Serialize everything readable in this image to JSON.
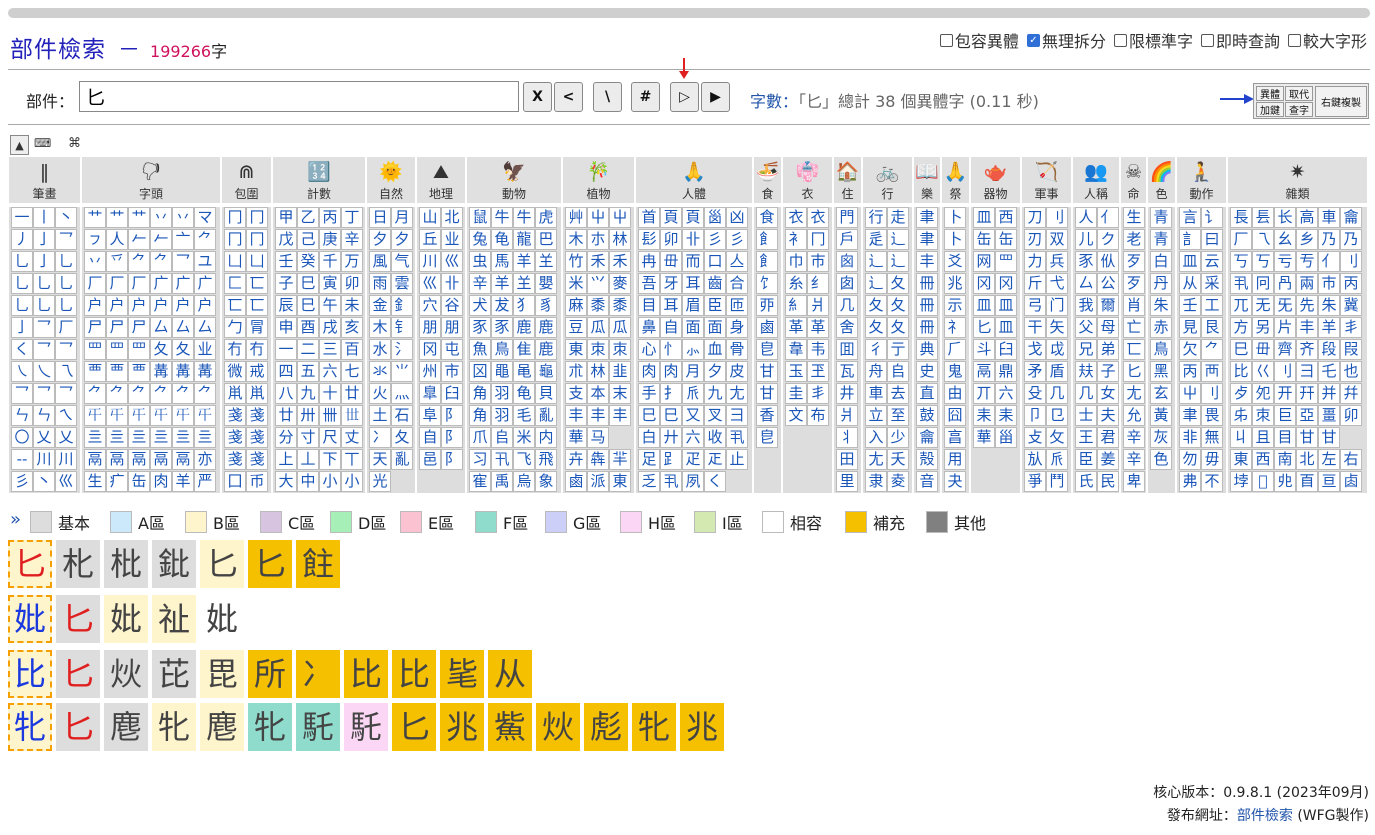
{
  "title": {
    "text": "部件檢索",
    "dash": "－",
    "count": "199266",
    "unit": "字"
  },
  "options": [
    {
      "label": "包容異體",
      "checked": false
    },
    {
      "label": "無理拆分",
      "checked": true
    },
    {
      "label": "限標準字",
      "checked": false
    },
    {
      "label": "即時查詢",
      "checked": false
    },
    {
      "label": "較大字形",
      "checked": false
    }
  ],
  "search": {
    "label": "部件：",
    "value": "匕"
  },
  "buttons": [
    "X",
    "<",
    "\\",
    "#",
    "▷",
    "▶"
  ],
  "info": {
    "label": "字數：",
    "text": "「匕」總計 38 個異體字 (0.11 秒)"
  },
  "mini_panel": {
    "b1": "異體",
    "b2": "取代",
    "b3": "加鍵",
    "b4": "查字",
    "b5": "右鍵複製"
  },
  "tools": {
    "triangle": "▲",
    "keyboard": "⌨",
    "command": "⌘"
  },
  "colors": {
    "accent": "#2255aa",
    "count": "#d0115d",
    "highlight": "#e02020",
    "cellText": "#1a56b8"
  },
  "categories": [
    {
      "label": "筆畫",
      "icon": "‖"
    },
    {
      "label": "字頭",
      "icon": "🖓"
    },
    {
      "label": "包圍",
      "icon": "⋒"
    },
    {
      "label": "計數",
      "icon": "🔢"
    },
    {
      "label": "自然",
      "icon": "🌞"
    },
    {
      "label": "地理",
      "icon": "⛰"
    },
    {
      "label": "動物",
      "icon": "🦅"
    },
    {
      "label": "植物",
      "icon": "🎋"
    },
    {
      "label": "人體",
      "icon": "🙏"
    },
    {
      "label": "食",
      "icon": "🍜"
    },
    {
      "label": "衣",
      "icon": "👘"
    },
    {
      "label": "住",
      "icon": "🏠"
    },
    {
      "label": "行",
      "icon": "🚲"
    },
    {
      "label": "樂",
      "icon": "📖"
    },
    {
      "label": "祭",
      "icon": "🙏"
    },
    {
      "label": "器物",
      "icon": "🫖"
    },
    {
      "label": "軍事",
      "icon": "🏹"
    },
    {
      "label": "人稱",
      "icon": "👥"
    },
    {
      "label": "命",
      "icon": "☠"
    },
    {
      "label": "色",
      "icon": "🌈"
    },
    {
      "label": "動作",
      "icon": "🧎"
    },
    {
      "label": "雜類",
      "icon": "✷"
    }
  ],
  "grid": [
    [
      "一",
      "丨",
      "丶",
      "艹",
      "艹",
      "艹",
      "丷",
      "丷",
      "マ",
      "冂",
      "冂",
      "甲",
      "乙",
      "丙",
      "丁",
      "日",
      "月",
      "山",
      "北",
      "鼠",
      "牛",
      "牛",
      "虎",
      "艸",
      "屮",
      "屮",
      "首",
      "頁",
      "頁",
      "𡿺",
      "凶",
      "食",
      "衣",
      "衣",
      "門",
      "行",
      "走",
      "聿",
      "卜",
      "皿",
      "西",
      "刀",
      "刂",
      "人",
      "亻",
      "生",
      "青",
      "言",
      "讠",
      "長",
      "镸",
      "长",
      "高",
      "車",
      "龠"
    ],
    [
      "丿",
      "亅",
      "乛",
      "ㇷ",
      "人",
      "𠂉",
      "𠂉",
      "亠",
      "⺈",
      "冂",
      "冂",
      "戊",
      "己",
      "庚",
      "辛",
      "夕",
      "夕",
      "丘",
      "业",
      "兔",
      "龟",
      "龍",
      "巴",
      "木",
      "朩",
      "林",
      "髟",
      "卯",
      "卝",
      "彡",
      "彡",
      "飠",
      "衤",
      "冂",
      "戶",
      "辵",
      "辶",
      "聿",
      "卜",
      "缶",
      "缶",
      "刃",
      "双",
      "儿",
      "ク",
      "老",
      "青",
      "訁",
      "曰",
      "厂",
      "乁",
      "幺",
      "乡",
      "乃",
      "乃"
    ],
    [
      "乚",
      "亅",
      "乚",
      "丷",
      "乊",
      "⺈",
      "⺈",
      "乛",
      "ユ",
      "凵",
      "凵",
      "壬",
      "癸",
      "千",
      "万",
      "風",
      "气",
      "川",
      "巛",
      "虫",
      "馬",
      "羊",
      "𦍌",
      "竹",
      "禾",
      "禾",
      "冉",
      "毌",
      "而",
      "口",
      "亼",
      "飠",
      "巾",
      "巿",
      "囪",
      "辶",
      "辶",
      "丰",
      "爻",
      "网",
      "罒",
      "力",
      "兵",
      "豕",
      "㐺",
      "歹",
      "白",
      "皿",
      "云",
      "丂",
      "丂",
      "亏",
      "亐",
      "亻",
      "刂"
    ],
    [
      "乚",
      "乚",
      "乚",
      "厂",
      "厂",
      "厂",
      "广",
      "广",
      "广",
      "匚",
      "匸",
      "子",
      "巳",
      "寅",
      "卯",
      "雨",
      "雲",
      "巛",
      "卝",
      "辛",
      "羊",
      "𦍌",
      "嬰",
      "米",
      "⺍",
      "麥",
      "吾",
      "牙",
      "耳",
      "齒",
      "合",
      "饣",
      "糸",
      "纟",
      "囱",
      "辶",
      "夂",
      "冊",
      "兆",
      "冈",
      "冈",
      "斤",
      "弋",
      "厶",
      "公",
      "歹",
      "丹",
      "从",
      "采",
      "丮",
      "冋",
      "冎",
      "兩",
      "巿",
      "丙"
    ],
    [
      "乚",
      "乚",
      "乚",
      "户",
      "户",
      "户",
      "户",
      "户",
      "户",
      "匸",
      "匸",
      "辰",
      "巳",
      "午",
      "未",
      "金",
      "釒",
      "穴",
      "谷",
      "犬",
      "犮",
      "犭",
      "豸",
      "麻",
      "黍",
      "黍",
      "目",
      "耳",
      "眉",
      "臣",
      "匝",
      "丣",
      "糹",
      "爿",
      "几",
      "夂",
      "夂",
      "冊",
      "示",
      "皿",
      "皿",
      "弓",
      "门",
      "我",
      "爾",
      "肖",
      "朱",
      "壬",
      "工",
      "兀",
      "无",
      "旡",
      "先",
      "朱",
      "冀"
    ],
    [
      "亅",
      "乛",
      "厂",
      "尸",
      "尸",
      "尸",
      "厶",
      "厶",
      "厶",
      "勹",
      "冐",
      "申",
      "酉",
      "戌",
      "亥",
      "木",
      "钅",
      "朋",
      "朋",
      "豕",
      "豕",
      "鹿",
      "鹿",
      "豆",
      "瓜",
      "瓜",
      "鼻",
      "自",
      "面",
      "面",
      "身",
      "鹵",
      "革",
      "革",
      "舍",
      "夂",
      "夂",
      "冊",
      "礻",
      "匕",
      "皿",
      "干",
      "矢",
      "父",
      "母",
      "亡",
      "赤",
      "見",
      "艮",
      "方",
      "另",
      "片",
      "丰",
      "羊",
      "丯"
    ],
    [
      "く",
      "乛",
      "乛",
      "罒",
      "罒",
      "罒",
      "夂",
      "夂",
      "业",
      "冇",
      "冇",
      "一",
      "二",
      "三",
      "百",
      "水",
      "氵",
      "冈",
      "屯",
      "魚",
      "鳥",
      "隹",
      "鹿",
      "東",
      "朿",
      "朿",
      "心",
      "忄",
      "⺗",
      "血",
      "骨",
      "皀",
      "韋",
      "韦",
      "囬",
      "彳",
      "亍",
      "典",
      "⺁",
      "斗",
      "臼",
      "戈",
      "戉",
      "兄",
      "弟",
      "匸",
      "鳥",
      "欠",
      "⺈",
      "巳",
      "毌",
      "齊",
      "齐",
      "段",
      "叚"
    ],
    [
      "㇏",
      "乀",
      "乁",
      "覀",
      "覀",
      "覀",
      "冓",
      "冓",
      "冓",
      "微",
      "戒",
      "四",
      "五",
      "六",
      "七",
      "氺",
      "⺌",
      "州",
      "市",
      "龱",
      "黽",
      "黾",
      "龜",
      "朮",
      "林",
      "韭",
      "肉",
      "肉",
      "月",
      "夕",
      "皮",
      "甘",
      "玉",
      "玊",
      "瓦",
      "舟",
      "𠂤",
      "史",
      "鬼",
      "鬲",
      "鼎",
      "矛",
      "盾",
      "㚘",
      "子",
      "匕",
      "黑",
      "丙",
      "襾",
      "比",
      "巜",
      "刂",
      "彐",
      "乇",
      "也"
    ],
    [
      "乛",
      "乛",
      "乛",
      "⺈",
      "⺈",
      "⺈",
      "⺈",
      "⺈",
      "⺈",
      "鼡",
      "鼡",
      "八",
      "九",
      "十",
      "廿",
      "火",
      "灬",
      "臯",
      "臼",
      "角",
      "羽",
      "龟",
      "貝",
      "支",
      "本",
      "末",
      "手",
      "扌",
      "𠂢",
      "九",
      "尢",
      "甘",
      "圭",
      "丯",
      "井",
      "車",
      "去",
      "直",
      "由",
      "丌",
      "六",
      "殳",
      "几",
      "几",
      "女",
      "尢",
      "玄",
      "屮",
      "刂",
      "歺",
      "夗",
      "开",
      "幵",
      "并",
      "幷"
    ],
    [
      "ㄣ",
      "ㄣ",
      "ㄟ",
      "𡕒",
      "𡕒",
      "𡕒",
      "𡕒",
      "𡕒",
      "𡕒",
      "戔",
      "戔",
      "廿",
      "卅",
      "卌",
      "𠀍",
      "土",
      "石",
      "阜",
      "阝",
      "角",
      "羽",
      "毛",
      "亂",
      "丰",
      "丰",
      "丰",
      "巳",
      "巳",
      "又",
      "叉",
      "彐",
      "香",
      "文",
      "布",
      "爿",
      "立",
      "至",
      "鼓",
      "囧",
      "耒",
      "耒",
      "卩",
      "㔾",
      "士",
      "夫",
      "允",
      "黃",
      "聿",
      "畏",
      "𠂔",
      "朿",
      "巨",
      "亞",
      "畺",
      "卯"
    ],
    [
      "〇",
      "乂",
      "乂",
      "亖",
      "亖",
      "亖",
      "亖",
      "亖",
      "亖",
      "戔",
      "戔",
      "分",
      "寸",
      "尺",
      "丈",
      "冫",
      "夂",
      "自",
      "阝",
      "爪",
      "𠂤",
      "米",
      "内",
      "華",
      "马",
      "",
      "白",
      "廾",
      "六",
      "收",
      "丮",
      "皀",
      "",
      "",
      "丬",
      "入",
      "少",
      "龠",
      "亯",
      "華",
      "甾",
      "攴",
      "攵",
      "王",
      "君",
      "辛",
      "灰",
      "非",
      "無",
      "丩",
      "且",
      "目",
      "甘",
      "甘"
    ],
    [
      "--",
      "川",
      "川",
      "鬲",
      "鬲",
      "鬲",
      "鬲",
      "鬲",
      "亦",
      "戔",
      "戔",
      "上",
      "丄",
      "下",
      "丅",
      "天",
      "亂",
      "邑",
      "阝",
      "习",
      "卂",
      "飞",
      "飛",
      "卉",
      "犇",
      "羋",
      "足",
      "𧾷",
      "疋",
      "𤴓",
      "止",
      "",
      "",
      "",
      "田",
      "尢",
      "夭",
      "殻",
      "用",
      "",
      "",
      "㫃",
      "𠂢",
      "臣",
      "姜",
      "辛",
      "色",
      "勿",
      "毋",
      "東",
      "西",
      "南",
      "北",
      "左",
      "右"
    ],
    [
      "彡",
      "丶",
      "巛",
      "生",
      "疒",
      "缶",
      "肉",
      "羊",
      "严",
      "囗",
      "币",
      "大",
      "中",
      "小",
      "小",
      "光",
      "",
      "",
      "",
      "寉",
      "禹",
      "烏",
      "象",
      "鹵",
      "派",
      "東",
      "乏",
      "丮",
      "夙",
      "く",
      "",
      "",
      "",
      "",
      "里",
      "隶",
      "夌",
      "音",
      "夬",
      "",
      "",
      "爭",
      "鬥",
      "氏",
      "民",
      "卑",
      "",
      "弗",
      "不",
      "𡋯",
      "𤰔",
      "𠑹",
      "𦣻",
      "亘",
      "𠧪"
    ]
  ],
  "legend": [
    {
      "label": "基本",
      "color": "#dddddd"
    },
    {
      "label": "A區",
      "color": "#cce8fb"
    },
    {
      "label": "B區",
      "color": "#fff5cc"
    },
    {
      "label": "C區",
      "color": "#d6c4e0"
    },
    {
      "label": "D區",
      "color": "#a6f0b8"
    },
    {
      "label": "E區",
      "color": "#fbc3d2"
    },
    {
      "label": "F區",
      "color": "#8fdccc"
    },
    {
      "label": "G區",
      "color": "#ccd0f8"
    },
    {
      "label": "H區",
      "color": "#fbd6f5"
    },
    {
      "label": "I區",
      "color": "#d4e8b2"
    },
    {
      "label": "相容",
      "color": "#ffffff"
    },
    {
      "label": "補充",
      "color": "#f5c000"
    },
    {
      "label": "其他",
      "color": "#808080"
    }
  ],
  "legend_more": "»",
  "results": [
    [
      {
        "ch": "匕",
        "bg": "#fff5cc",
        "color": "#e02020",
        "frame": true
      },
      {
        "ch": "朼",
        "bg": "#dddddd",
        "color": "#444"
      },
      {
        "ch": "枇",
        "bg": "#dddddd",
        "color": "#444"
      },
      {
        "ch": "鈚",
        "bg": "#dddddd",
        "color": "#444"
      },
      {
        "ch": "匕",
        "bg": "#fff5cc",
        "color": "#444"
      },
      {
        "ch": "匕",
        "bg": "#f5c000",
        "color": "#444"
      },
      {
        "ch": "飳",
        "bg": "#f5c000",
        "color": "#444"
      }
    ],
    [
      {
        "ch": "妣",
        "bg": "#fff5cc",
        "color": "#1a3adf",
        "frame": true
      },
      {
        "ch": "匕",
        "bg": "#dddddd",
        "color": "#e02020"
      },
      {
        "ch": "妣",
        "bg": "#fff5cc",
        "color": "#444"
      },
      {
        "ch": "祉",
        "bg": "#fff5cc",
        "color": "#444"
      },
      {
        "ch": "妣",
        "bg": "#ffffff",
        "color": "#444"
      }
    ],
    [
      {
        "ch": "比",
        "bg": "#fff5cc",
        "color": "#1a3adf",
        "frame": true
      },
      {
        "ch": "匕",
        "bg": "#dddddd",
        "color": "#e02020"
      },
      {
        "ch": "炏",
        "bg": "#dddddd",
        "color": "#444"
      },
      {
        "ch": "芘",
        "bg": "#dddddd",
        "color": "#444"
      },
      {
        "ch": "毘",
        "bg": "#fff5cc",
        "color": "#444"
      },
      {
        "ch": "所",
        "bg": "#f5c000",
        "color": "#444"
      },
      {
        "ch": "冫",
        "bg": "#f5c000",
        "color": "#444"
      },
      {
        "ch": "比",
        "bg": "#f5c000",
        "color": "#444"
      },
      {
        "ch": "比",
        "bg": "#f5c000",
        "color": "#444"
      },
      {
        "ch": "毞",
        "bg": "#f5c000",
        "color": "#444"
      },
      {
        "ch": "从",
        "bg": "#f5c000",
        "color": "#444"
      }
    ],
    [
      {
        "ch": "牝",
        "bg": "#fff5cc",
        "color": "#1a3adf",
        "frame": true
      },
      {
        "ch": "匕",
        "bg": "#dddddd",
        "color": "#e02020"
      },
      {
        "ch": "麀",
        "bg": "#dddddd",
        "color": "#444"
      },
      {
        "ch": "牝",
        "bg": "#fff5cc",
        "color": "#444"
      },
      {
        "ch": "麀",
        "bg": "#fff5cc",
        "color": "#444"
      },
      {
        "ch": "牝",
        "bg": "#8fdccc",
        "color": "#444"
      },
      {
        "ch": "馲",
        "bg": "#8fdccc",
        "color": "#444"
      },
      {
        "ch": "馲",
        "bg": "#fbd6f5",
        "color": "#444"
      },
      {
        "ch": "匕",
        "bg": "#f5c000",
        "color": "#444"
      },
      {
        "ch": "兆",
        "bg": "#f5c000",
        "color": "#444"
      },
      {
        "ch": "鮆",
        "bg": "#f5c000",
        "color": "#444"
      },
      {
        "ch": "炏",
        "bg": "#f5c000",
        "color": "#444"
      },
      {
        "ch": "彪",
        "bg": "#f5c000",
        "color": "#444"
      },
      {
        "ch": "牝",
        "bg": "#f5c000",
        "color": "#444"
      },
      {
        "ch": "兆",
        "bg": "#f5c000",
        "color": "#444"
      }
    ]
  ],
  "footer": {
    "version": "核心版本：0.9.8.1 (2023年09月)",
    "url_label": "發布網址：",
    "url_link": "部件檢索",
    "url_suffix": " (WFG製作)"
  }
}
